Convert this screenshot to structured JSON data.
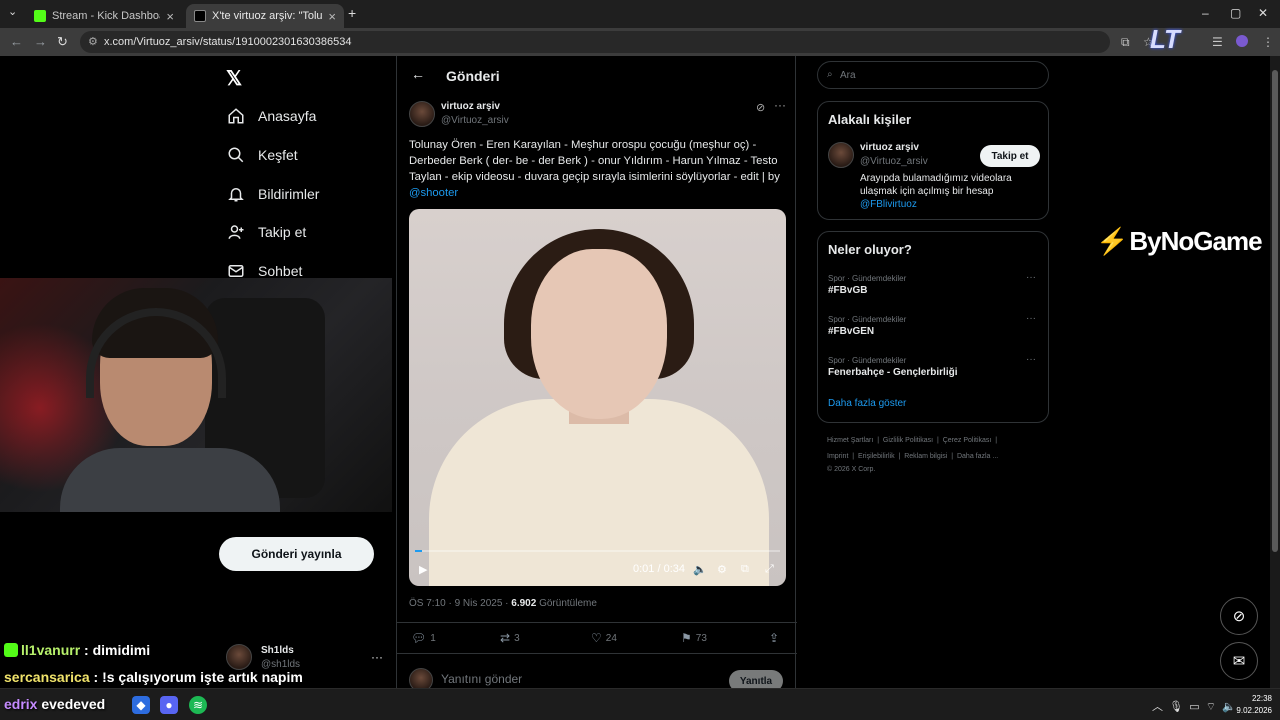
{
  "browser": {
    "tabs": [
      {
        "title": "Stream - Kick Dashboard",
        "favicon_color": "#53fc18"
      },
      {
        "title": "X'te virtuoz arşiv: \"Tolunay Ören",
        "favicon_color": "#000000"
      }
    ],
    "new_tab": "+",
    "url": "x.com/Virtuoz_arsiv/status/1910002301630386534"
  },
  "nav": {
    "items": [
      {
        "label": "Anasayfa",
        "icon": "home-icon"
      },
      {
        "label": "Keşfet",
        "icon": "search-icon"
      },
      {
        "label": "Bildirimler",
        "icon": "bell-icon"
      },
      {
        "label": "Takip et",
        "icon": "follow-icon"
      },
      {
        "label": "Sohbet",
        "icon": "mail-icon"
      }
    ],
    "post_button": "Gönderi yayınla",
    "account": {
      "name": "Sh1lds",
      "handle": "@sh1lds"
    }
  },
  "post": {
    "header_title": "Gönderi",
    "author_name": "virtuoz arşiv",
    "author_handle": "@Virtuoz_arsiv",
    "text": "Tolunay Ören - Eren Karayılan - Meşhur orospu çocuğu (meşhur oç) - Derbeder Berk ( der- be - der Berk ) - onur Yıldırım - Harun Yılmaz - Testo Taylan - ekip videosu - duvara geçip sırayla isimlerini söylüyorlar - edit | by ",
    "mention": "@shooter",
    "video": {
      "time": "0:01 / 0:34",
      "progress_fraction": 0.02
    },
    "timestamp": "ÖS 7:10 · 9 Nis 2025 · ",
    "views_count": "6.902",
    "views_label": " Görüntüleme",
    "stats": {
      "replies": "1",
      "reposts": "3",
      "likes": "24",
      "bookmarks": "73"
    },
    "reply_placeholder": "Yanıtını gönder",
    "reply_button": "Yanıtla"
  },
  "sidebar": {
    "search_placeholder": "Ara",
    "related": {
      "title": "Alakalı kişiler",
      "name": "virtuoz arşiv",
      "handle": "@Virtuoz_arsiv",
      "follow_label": "Takip et",
      "bio": "Arayıpda bulamadığımız videolara ulaşmak için açılmış bir hesap ",
      "bio_mention": "@FBlivirtuoz"
    },
    "trends": {
      "title": "Neler oluyor?",
      "items": [
        {
          "category": "Spor · Gündemdekiler",
          "name": "#FBvGB"
        },
        {
          "category": "Spor · Gündemdekiler",
          "name": "#FBvGEN"
        },
        {
          "category": "Spor · Gündemdekiler",
          "name": "Fenerbahçe - Gençlerbirliği"
        }
      ],
      "show_more": "Daha fazla göster"
    },
    "footer": {
      "links_row1": [
        "Hizmet Şartları",
        "|",
        "Gizlilik Politikası",
        "|",
        "Çerez Politikası",
        "|"
      ],
      "links_row2": [
        "Imprint",
        "|",
        "Erişilebilirlik",
        "|",
        "Reklam bilgisi",
        "|",
        "Daha fazla ..."
      ],
      "copyright": "© 2026 X Corp."
    }
  },
  "overlays": {
    "sponsor": "ByNoGame",
    "lt_logo": "LT",
    "chat": [
      {
        "user": "ll1vanurr",
        "message": " : dimidimi"
      },
      {
        "user": "sercansarica",
        "message": " : !s çalışıyorum işte artık napim"
      }
    ],
    "taskbar_text": "evedeved",
    "taskbar_prefix": "edrix"
  },
  "system": {
    "time": "22:38",
    "date": "9.02.2026"
  },
  "colors": {
    "accent": "#1d9bf0",
    "kick": "#53fc18",
    "bg": "#000000"
  }
}
